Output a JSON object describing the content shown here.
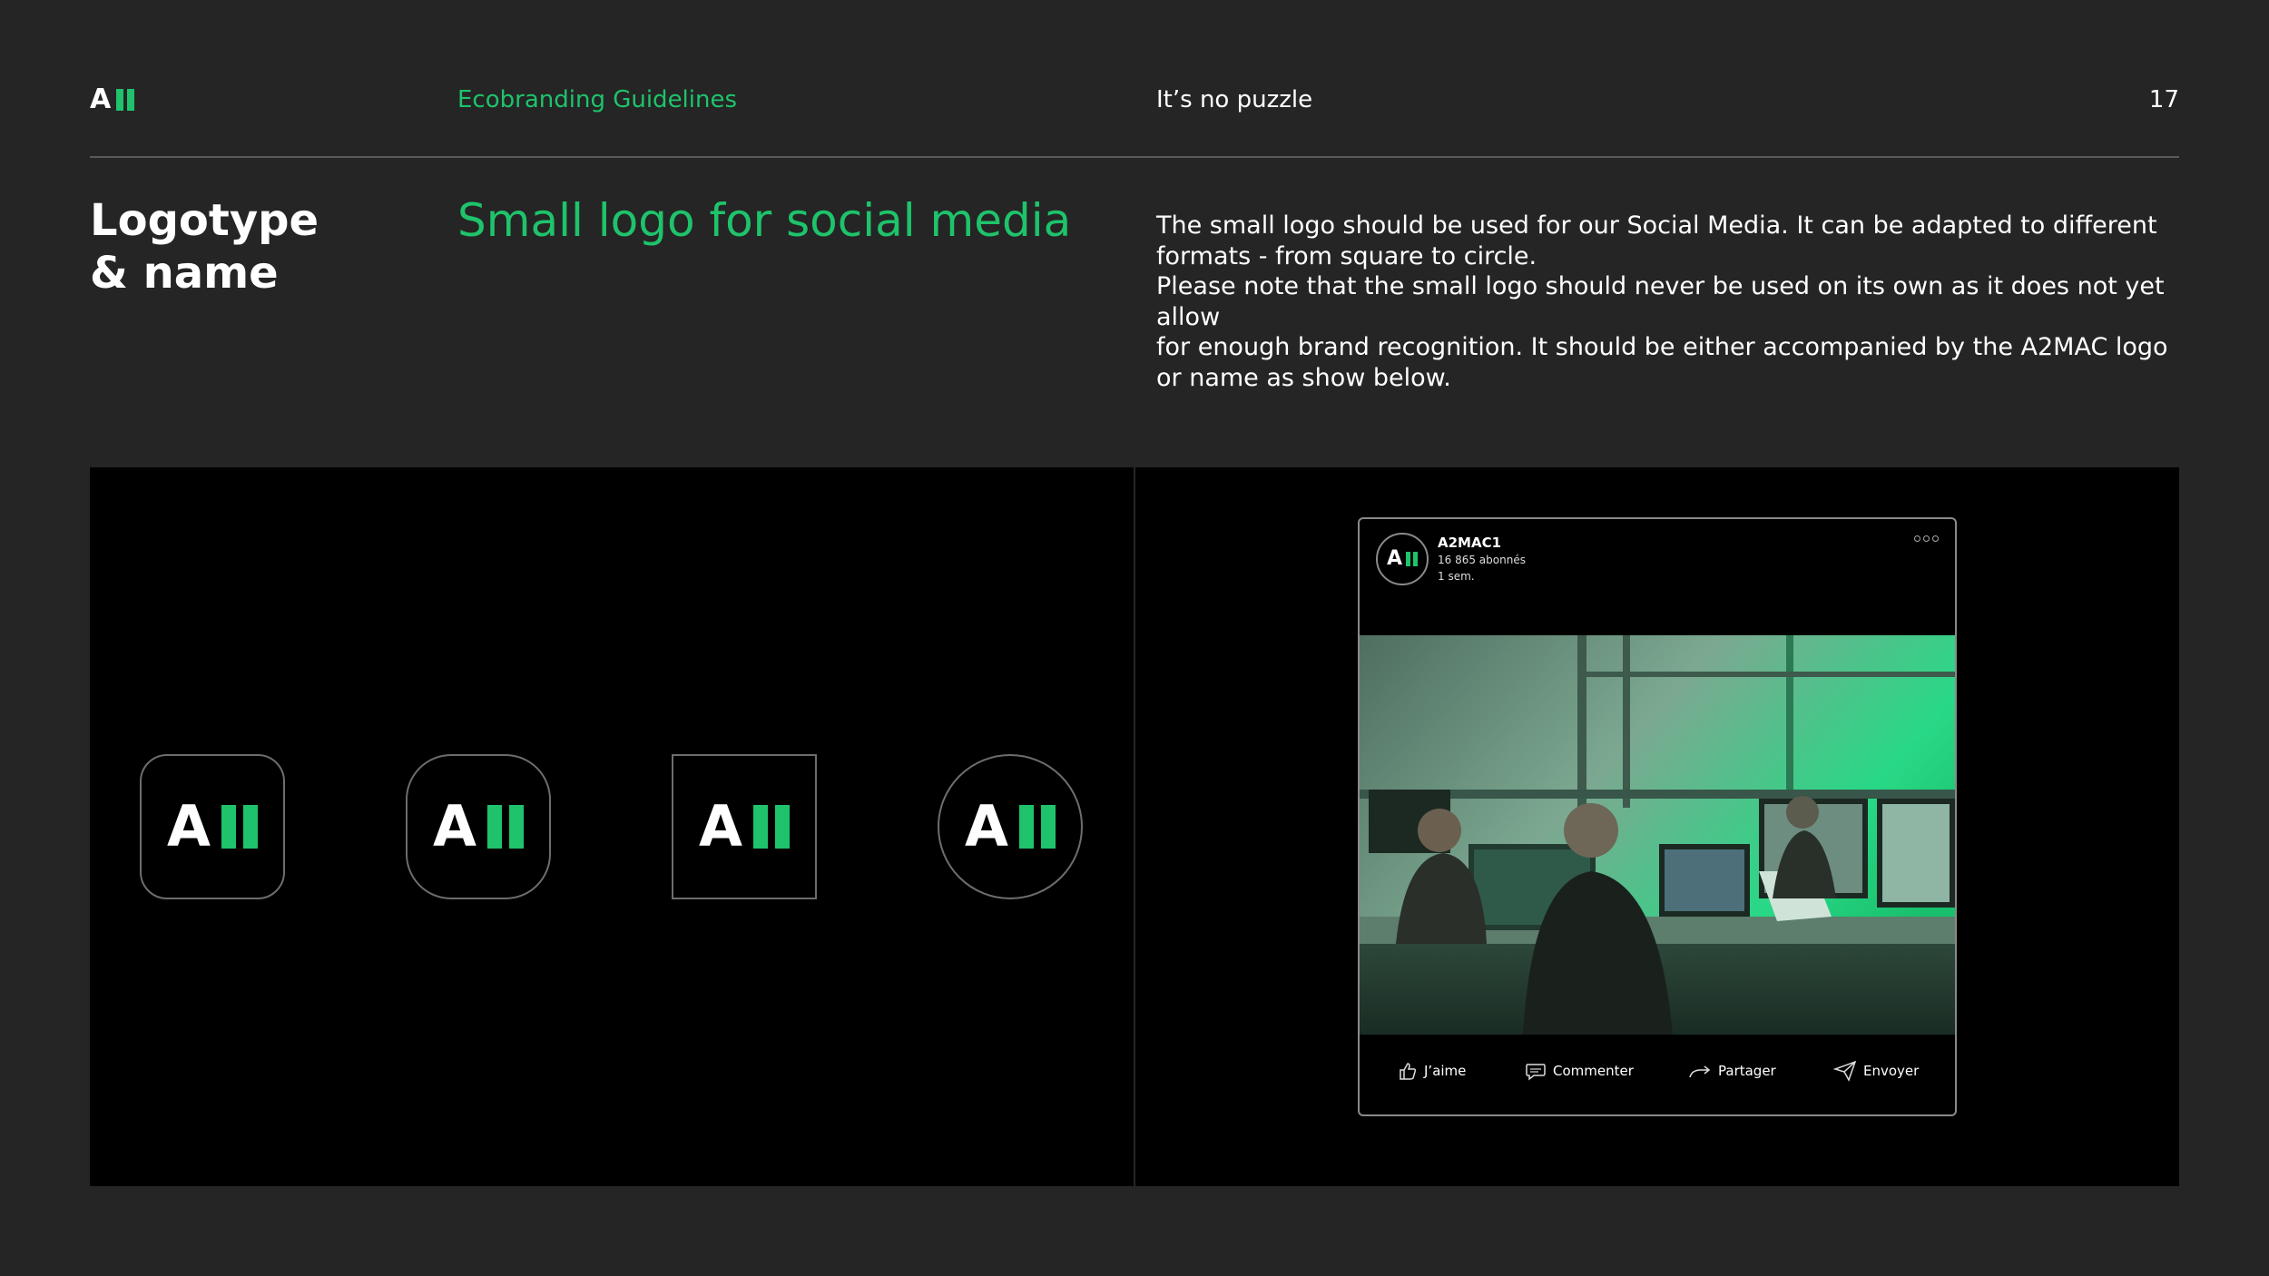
{
  "header": {
    "logo_letter": "A",
    "section": "Ecobranding Guidelines",
    "tagline": "It’s no puzzle",
    "page_number": "17"
  },
  "title": "Logotype\n& name",
  "subtitle": "Small logo for social media",
  "description": "The small logo should be used for our Social Media. It can be adapted to different\nformats - from square to circle.\nPlease note that the small logo should never be used on its own as it does not yet allow\nfor enough brand recognition. It should be either accompanied by the A2MAC logo\nor name as show below.",
  "logo_variants": [
    {
      "shape": "rounded-square",
      "letter": "A"
    },
    {
      "shape": "squircle",
      "letter": "A"
    },
    {
      "shape": "square",
      "letter": "A"
    },
    {
      "shape": "circle",
      "letter": "A"
    }
  ],
  "post": {
    "account_name": "A2MAC1",
    "followers": "16 865 abonnés",
    "time": "1 sem.",
    "avatar_letter": "A",
    "actions": [
      {
        "icon": "thumbs-up-icon",
        "label": "J’aime"
      },
      {
        "icon": "comment-icon",
        "label": "Commenter"
      },
      {
        "icon": "share-arrow-icon",
        "label": "Partager"
      },
      {
        "icon": "send-icon",
        "label": "Envoyer"
      }
    ]
  },
  "colors": {
    "brand_green": "#1ec36b",
    "background": "#252525",
    "panel": "#000000"
  }
}
